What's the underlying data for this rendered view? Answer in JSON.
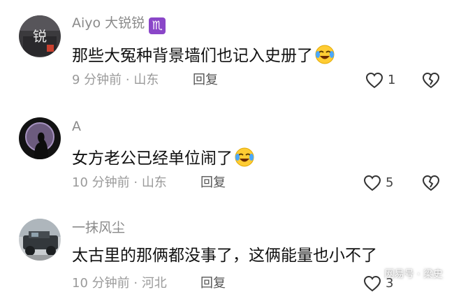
{
  "comments": [
    {
      "username": "Aiyo 大锐锐",
      "badge_symbol": "♏",
      "badge_color": "#8a46c8",
      "text": "那些大冤种背景墙们也记入史册了",
      "emoji": "laughing-crying-emoji",
      "time": "9 分钟前",
      "location": "山东",
      "reply_label": "回复",
      "likes": "1"
    },
    {
      "username": "A",
      "text": "女方老公已经单位闹了",
      "emoji": "laughing-crying-emoji",
      "time": "10 分钟前",
      "location": "山东",
      "reply_label": "回复",
      "likes": "5"
    },
    {
      "username": "一抹风尘",
      "text": "太古里的那俩都没事了，这俩能量也小不了",
      "time": "10 分钟前",
      "location": "河北",
      "reply_label": "回复",
      "likes": "3"
    }
  ],
  "watermark": "网易号 · 梁史",
  "colors": {
    "meta": "#9a9a9a",
    "text": "#111111",
    "badge": "#8a46c8"
  }
}
